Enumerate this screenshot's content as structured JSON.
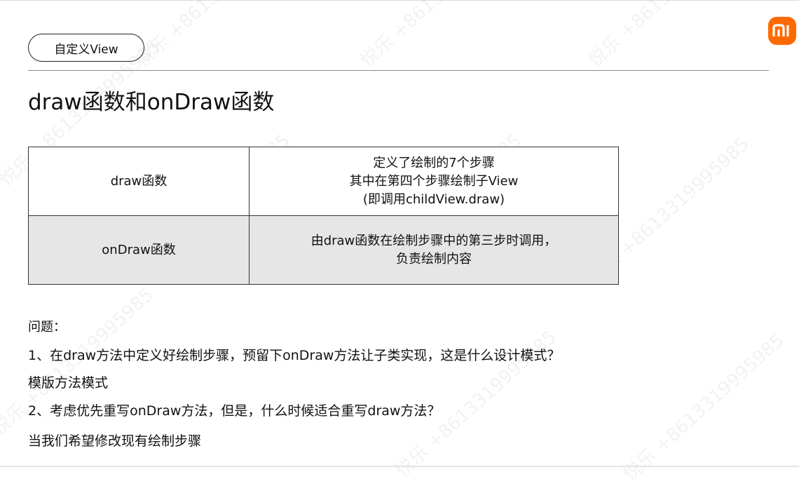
{
  "header": {
    "tag": "自定义View",
    "logo_text": "mi"
  },
  "title": "draw函数和onDraw函数",
  "table": {
    "rows": [
      {
        "name": "draw函数",
        "desc": [
          "定义了绘制的7个步骤",
          "其中在第四个步骤绘制子View",
          "(即调用childView.draw)"
        ]
      },
      {
        "name": "onDraw函数",
        "desc": [
          "由draw函数在绘制步骤中的第三步时调用，",
          "负责绘制内容"
        ]
      }
    ]
  },
  "qa": {
    "heading": "问题：",
    "q1": "1、在draw方法中定义好绘制步骤，预留下onDraw方法让子类实现，这是什么设计模式？",
    "a1": "模版方法模式",
    "q2": "2、考虑优先重写onDraw方法，但是，什么时候适合重写draw方法？",
    "a2": "当我们希望修改现有绘制步骤"
  },
  "watermark": {
    "text": "悦乐 +8613319995985"
  },
  "colors": {
    "brand": "#ff6a00",
    "row_alt": "#e6e6e6"
  }
}
